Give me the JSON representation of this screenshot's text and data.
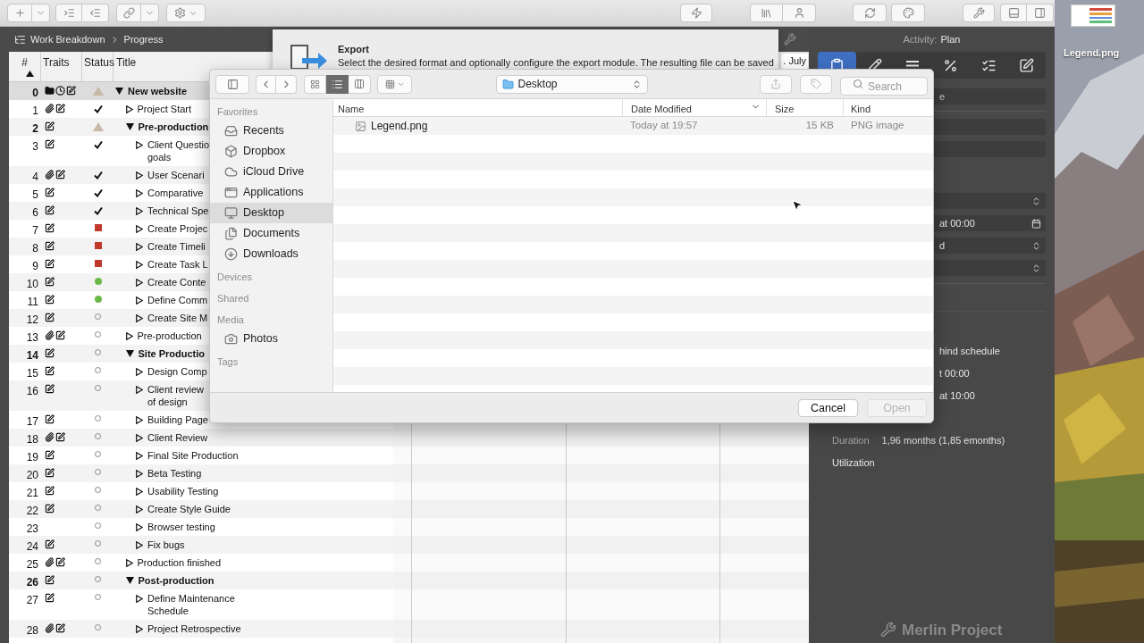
{
  "breadcrumb": [
    "Work Breakdown",
    "Progress"
  ],
  "table": {
    "columns": [
      "#",
      "Traits",
      "Status",
      "Title"
    ],
    "rows": [
      {
        "num": "0",
        "title": "New website",
        "traits": [
          {
            "kind": "folder"
          },
          {
            "kind": "clock"
          },
          {
            "kind": "note"
          }
        ],
        "status": {
          "kind": "warning"
        },
        "selected": true,
        "expanded": true,
        "children": [
          {
            "num": "1",
            "title": "Project Start",
            "traits": [
              {
                "kind": "attachment"
              },
              {
                "kind": "note"
              }
            ],
            "status": {
              "kind": "done"
            },
            "selected": false,
            "expanded": false
          },
          {
            "num": "2",
            "title": "Pre-production",
            "traits": [
              {
                "kind": "note"
              }
            ],
            "status": {
              "kind": "warning"
            },
            "selected": false,
            "expanded": true,
            "children": [
              {
                "num": "3",
                "title": "Client Questio\ngoals",
                "traits": [
                  {
                    "kind": "note"
                  }
                ],
                "status": {
                  "kind": "done"
                },
                "selected": false,
                "expanded": false
              },
              {
                "num": "4",
                "title": "User Scenari",
                "traits": [
                  {
                    "kind": "attachment"
                  },
                  {
                    "kind": "note"
                  }
                ],
                "status": {
                  "kind": "done"
                },
                "selected": false,
                "expanded": false
              },
              {
                "num": "5",
                "title": "Comparative",
                "traits": [
                  {
                    "kind": "note"
                  }
                ],
                "status": {
                  "kind": "done"
                },
                "selected": false,
                "expanded": false
              },
              {
                "num": "6",
                "title": "Technical Spe",
                "traits": [
                  {
                    "kind": "note"
                  }
                ],
                "status": {
                  "kind": "done"
                },
                "selected": false,
                "expanded": false
              },
              {
                "num": "7",
                "title": "Create Projec",
                "traits": [
                  {
                    "kind": "note"
                  }
                ],
                "status": {
                  "kind": "critical"
                },
                "selected": false,
                "expanded": false
              },
              {
                "num": "8",
                "title": "Create Timeli",
                "traits": [
                  {
                    "kind": "note"
                  }
                ],
                "status": {
                  "kind": "critical"
                },
                "selected": false,
                "expanded": false
              },
              {
                "num": "9",
                "title": "Create Task L",
                "traits": [
                  {
                    "kind": "note"
                  }
                ],
                "status": {
                  "kind": "critical"
                },
                "selected": false,
                "expanded": false
              },
              {
                "num": "10",
                "title": "Create Conte",
                "traits": [
                  {
                    "kind": "note"
                  }
                ],
                "status": {
                  "kind": "active"
                },
                "selected": false,
                "expanded": false
              },
              {
                "num": "11",
                "title": "Define Comm",
                "traits": [
                  {
                    "kind": "note"
                  }
                ],
                "status": {
                  "kind": "active"
                },
                "selected": false,
                "expanded": false
              },
              {
                "num": "12",
                "title": "Create Site M",
                "traits": [
                  {
                    "kind": "note"
                  }
                ],
                "status": {
                  "kind": "open"
                },
                "selected": false,
                "expanded": false
              }
            ]
          },
          {
            "num": "13",
            "title": "Pre-production",
            "traits": [
              {
                "kind": "attachment"
              },
              {
                "kind": "note"
              }
            ],
            "status": {
              "kind": "open"
            },
            "selected": false,
            "expanded": false
          },
          {
            "num": "14",
            "title": "Site Productio",
            "traits": [
              {
                "kind": "note"
              }
            ],
            "status": {
              "kind": "open"
            },
            "selected": false,
            "expanded": true,
            "children": [
              {
                "num": "15",
                "title": "Design Comp",
                "traits": [
                  {
                    "kind": "note"
                  }
                ],
                "status": {
                  "kind": "open"
                },
                "selected": false,
                "expanded": false
              },
              {
                "num": "16",
                "title": "Client review\nof design",
                "traits": [
                  {
                    "kind": "note"
                  }
                ],
                "status": {
                  "kind": "open"
                },
                "selected": false,
                "expanded": false
              },
              {
                "num": "17",
                "title": "Building Page",
                "traits": [
                  {
                    "kind": "note"
                  }
                ],
                "status": {
                  "kind": "open"
                },
                "selected": false,
                "expanded": false
              },
              {
                "num": "18",
                "title": "Client Review",
                "traits": [
                  {
                    "kind": "attachment"
                  },
                  {
                    "kind": "note"
                  }
                ],
                "status": {
                  "kind": "open"
                },
                "selected": false,
                "expanded": false
              },
              {
                "num": "19",
                "title": "Final Site Production",
                "traits": [
                  {
                    "kind": "note"
                  }
                ],
                "status": {
                  "kind": "open"
                },
                "selected": false,
                "expanded": false
              },
              {
                "num": "20",
                "title": "Beta Testing",
                "traits": [
                  {
                    "kind": "note"
                  }
                ],
                "status": {
                  "kind": "open"
                },
                "selected": false,
                "expanded": false
              },
              {
                "num": "21",
                "title": "Usability Testing",
                "traits": [
                  {
                    "kind": "note"
                  }
                ],
                "status": {
                  "kind": "open"
                },
                "selected": false,
                "expanded": false
              },
              {
                "num": "22",
                "title": "Create Style Guide",
                "traits": [
                  {
                    "kind": "note"
                  }
                ],
                "status": {
                  "kind": "open"
                },
                "selected": false,
                "expanded": false
              },
              {
                "num": "23",
                "title": "Browser testing",
                "status": {
                  "kind": "open"
                },
                "selected": false,
                "expanded": false
              },
              {
                "num": "24",
                "title": "Fix bugs",
                "traits": [
                  {
                    "kind": "note"
                  }
                ],
                "status": {
                  "kind": "open"
                },
                "selected": false,
                "expanded": false
              }
            ]
          },
          {
            "num": "25",
            "title": "Production finished",
            "traits": [
              {
                "kind": "attachment"
              },
              {
                "kind": "note"
              }
            ],
            "status": {
              "kind": "open"
            },
            "selected": false,
            "expanded": false
          },
          {
            "num": "26",
            "title": "Post-production",
            "traits": [
              {
                "kind": "note"
              }
            ],
            "status": {
              "kind": "open"
            },
            "selected": false,
            "expanded": true,
            "children": [
              {
                "num": "27",
                "title": "Define Maintenance\nSchedule",
                "traits": [
                  {
                    "kind": "note"
                  }
                ],
                "status": {
                  "kind": "open"
                },
                "selected": false,
                "expanded": false
              },
              {
                "num": "28",
                "title": "Project Retrospective",
                "traits": [
                  {
                    "kind": "attachment"
                  },
                  {
                    "kind": "note"
                  }
                ],
                "status": {
                  "kind": "open"
                },
                "selected": false,
                "expanded": false
              }
            ]
          }
        ]
      }
    ]
  },
  "timeline": {
    "header": ". July"
  },
  "export_sheet": {
    "title": "Export",
    "description": "Select the desired format and optionally configure the export module. The resulting file can be saved"
  },
  "inspector": {
    "activity_label": "Activity:",
    "activity_value": "Plan",
    "tabs": [
      {
        "selected": true
      },
      {
        "selected": false
      },
      {
        "selected": false
      },
      {
        "selected": false
      },
      {
        "selected": false
      },
      {
        "selected": false
      }
    ],
    "fields": [
      {
        "kind": "text",
        "value": "e"
      },
      {
        "kind": "text"
      },
      {
        "kind": "text"
      }
    ],
    "popups": [
      {
        "kind": "popup"
      },
      {
        "kind": "date",
        "value": "at 00:00"
      },
      {
        "kind": "popup",
        "value": "d"
      },
      {
        "kind": "popup"
      }
    ],
    "details": [
      "hind schedule",
      "t 00:00",
      "at 10:00"
    ],
    "summary": [
      {
        "label": "Duration",
        "value": "1,96 months (1,85 emonths)"
      },
      {
        "label": "Utilization"
      }
    ],
    "branding": "Merlin Project"
  },
  "dialog": {
    "location": "Desktop",
    "search_placeholder": "Search",
    "sidebar": [
      {
        "title": "Favorites",
        "items": [
          {
            "label": "Recents",
            "selected": false
          },
          {
            "label": "Dropbox",
            "selected": false
          },
          {
            "label": "iCloud Drive",
            "selected": false
          },
          {
            "label": "Applications",
            "selected": false
          },
          {
            "label": "Desktop",
            "selected": true
          },
          {
            "label": "Documents",
            "selected": false
          },
          {
            "label": "Downloads",
            "selected": false
          }
        ]
      },
      {
        "title": "Devices"
      },
      {
        "title": "Shared"
      },
      {
        "title": "Media",
        "items": [
          {
            "label": "Photos",
            "selected": false
          }
        ]
      },
      {
        "title": "Tags"
      }
    ],
    "columns": [
      "Name",
      "Date Modified",
      "Size",
      "Kind"
    ],
    "files": [
      {
        "name": "Legend.png",
        "modified": "Today at 19:57",
        "size": "15 KB",
        "kind": "PNG image"
      }
    ],
    "buttons": [
      {
        "label": "Cancel",
        "disabled": false
      },
      {
        "label": "Open",
        "disabled": true
      }
    ]
  },
  "desktop": {
    "file_label": "Legend.png"
  }
}
